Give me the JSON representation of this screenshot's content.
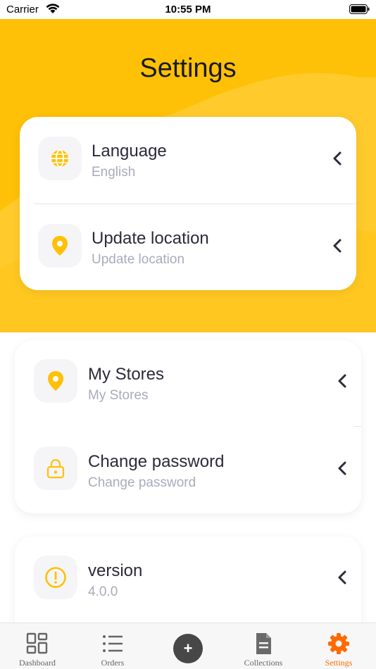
{
  "status_bar": {
    "carrier": "Carrier",
    "time": "10:55 PM"
  },
  "header": {
    "title": "Settings"
  },
  "colors": {
    "accent": "#FFC107",
    "active_tab": "#FF6A00",
    "subtitle": "#A8ACBB"
  },
  "cards": [
    {
      "items": [
        {
          "icon": "globe-icon",
          "title": "Language",
          "subtitle": "English"
        },
        {
          "icon": "location-pin-icon",
          "title": "Update location",
          "subtitle": "Update location"
        }
      ]
    },
    {
      "items": [
        {
          "icon": "location-pin-icon",
          "title": "My Stores",
          "subtitle": "My Stores"
        },
        {
          "icon": "lock-icon",
          "title": "Change password",
          "subtitle": "Change password"
        }
      ]
    },
    {
      "items": [
        {
          "icon": "info-circle-icon",
          "title": "version",
          "subtitle": "4.0.0"
        }
      ]
    }
  ],
  "tabbar": {
    "tabs": [
      {
        "icon": "dashboard-icon",
        "label": "Dashboard",
        "active": false
      },
      {
        "icon": "list-icon",
        "label": "Orders",
        "active": false
      },
      {
        "icon": "plus-icon",
        "label": "",
        "active": false
      },
      {
        "icon": "document-icon",
        "label": "Collections",
        "active": false
      },
      {
        "icon": "gear-icon",
        "label": "Settings",
        "active": true
      }
    ]
  }
}
